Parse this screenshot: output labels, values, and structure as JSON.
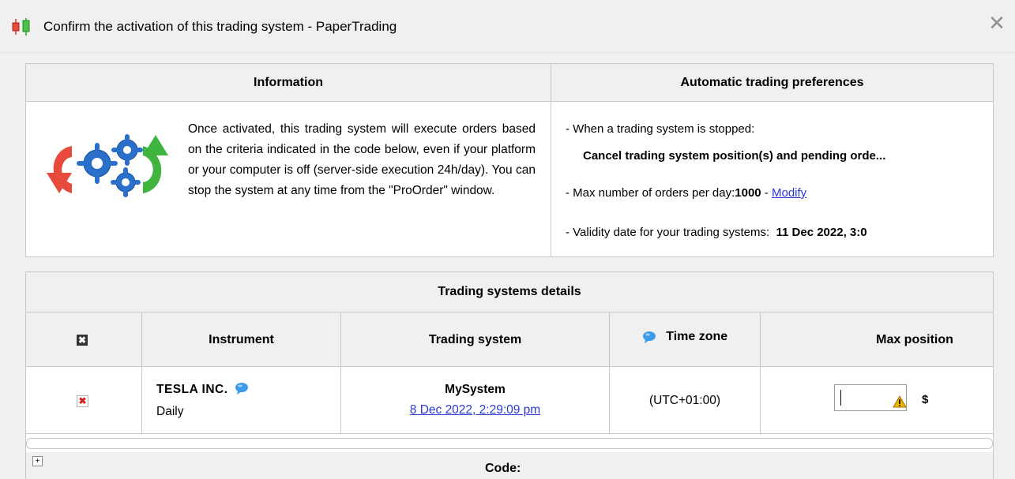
{
  "window": {
    "title": "Confirm the activation of this trading system  - PaperTrading",
    "close_symbol": "✕"
  },
  "info": {
    "header": "Information",
    "text": "Once activated, this trading system will execute orders based on the criteria indicated in the code below, even if your platform or your computer is off (server-side execution 24h/day). You can stop the system at any time from the \"ProOrder\" window."
  },
  "preferences": {
    "header": "Automatic trading preferences",
    "stopped_label": "- When a trading system is stopped:",
    "stopped_value": "Cancel trading system position(s) and pending orde...",
    "max_orders_label": "- Max number of orders per day:",
    "max_orders_value": "1000",
    "max_orders_sep": " - ",
    "modify_link": "Modify",
    "validity_label": "- Validity date for your trading systems:  ",
    "validity_value": "11 Dec 2022, 3:0"
  },
  "details": {
    "header": "Trading systems details",
    "columns": {
      "delete": "✖",
      "instrument": "Instrument",
      "trading_system": "Trading system",
      "time_zone": "Time zone",
      "max_position": "Max position"
    },
    "row": {
      "delete": "✖",
      "instrument_name": "TESLA INC.",
      "instrument_period": "Daily",
      "system_name": "MySystem",
      "system_date": "8 Dec 2022, 2:29:09 pm",
      "time_zone": "(UTC+01:00)",
      "max_position_value": "",
      "currency": "$"
    },
    "code_label": "Code:",
    "expand_symbol": "+"
  },
  "colors": {
    "link": "#2838d8",
    "bubble": "#3b9be8",
    "warning": "#f0b400",
    "delete": "#d32020"
  }
}
